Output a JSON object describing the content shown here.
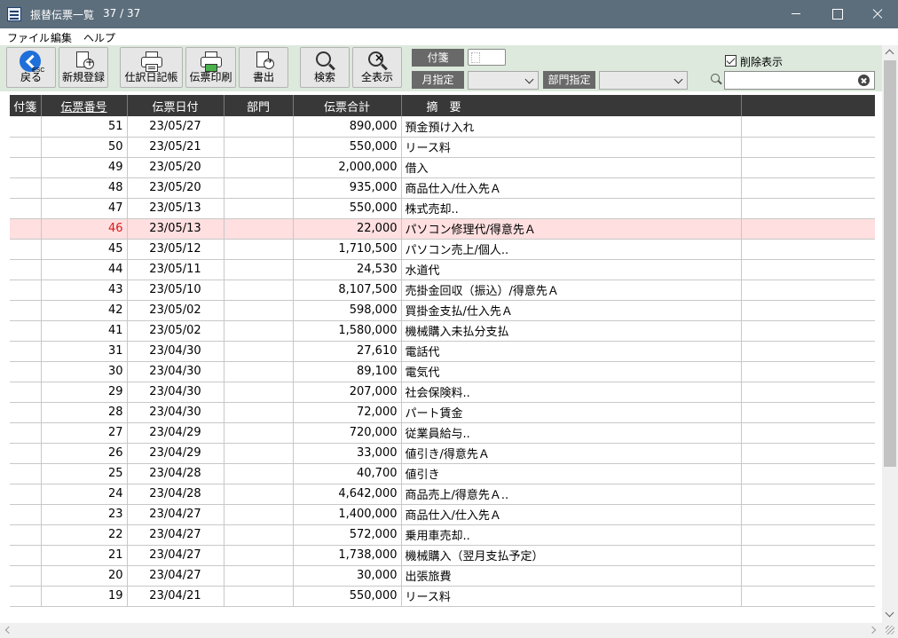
{
  "window": {
    "title": "振替伝票一覧",
    "count": "37 / 37"
  },
  "menu": [
    "ファイル",
    "編集",
    "ヘルプ"
  ],
  "toolbar": {
    "back_label": "戻る",
    "esc_label": "ESC",
    "new_label": "新規登録",
    "journal_label": "仕訳日記帳",
    "print_label": "伝票印刷",
    "export_label": "書出",
    "search_label": "検索",
    "showall_label": "全表示",
    "fusen_label": "付箋",
    "month_label": "月指定",
    "month_value": "",
    "dept_label": "部門指定",
    "dept_value": "",
    "deleted_label": "削除表示",
    "deleted_checked": true,
    "search_value": ""
  },
  "table": {
    "columns": [
      "付箋",
      "伝票番号",
      "伝票日付",
      "部門",
      "伝票合計",
      "摘　要"
    ],
    "highlight_row": 5,
    "rows": [
      {
        "fusen": "",
        "no": "51",
        "date": "23/05/27",
        "dept": "",
        "total": "890,000",
        "desc": "預金預け入れ"
      },
      {
        "fusen": "",
        "no": "50",
        "date": "23/05/21",
        "dept": "",
        "total": "550,000",
        "desc": "リース料"
      },
      {
        "fusen": "",
        "no": "49",
        "date": "23/05/20",
        "dept": "",
        "total": "2,000,000",
        "desc": "借入"
      },
      {
        "fusen": "",
        "no": "48",
        "date": "23/05/20",
        "dept": "",
        "total": "935,000",
        "desc": "商品仕入/仕入先Ａ"
      },
      {
        "fusen": "",
        "no": "47",
        "date": "23/05/13",
        "dept": "",
        "total": "550,000",
        "desc": "株式売却.."
      },
      {
        "fusen": "",
        "no": "46",
        "date": "23/05/13",
        "dept": "",
        "total": "22,000",
        "desc": "パソコン修理代/得意先Ａ"
      },
      {
        "fusen": "",
        "no": "45",
        "date": "23/05/12",
        "dept": "",
        "total": "1,710,500",
        "desc": "パソコン売上/個人.."
      },
      {
        "fusen": "",
        "no": "44",
        "date": "23/05/11",
        "dept": "",
        "total": "24,530",
        "desc": "水道代"
      },
      {
        "fusen": "",
        "no": "43",
        "date": "23/05/10",
        "dept": "",
        "total": "8,107,500",
        "desc": "売掛金回収（振込）/得意先Ａ"
      },
      {
        "fusen": "",
        "no": "42",
        "date": "23/05/02",
        "dept": "",
        "total": "598,000",
        "desc": "買掛金支払/仕入先Ａ"
      },
      {
        "fusen": "",
        "no": "41",
        "date": "23/05/02",
        "dept": "",
        "total": "1,580,000",
        "desc": "機械購入未払分支払"
      },
      {
        "fusen": "",
        "no": "31",
        "date": "23/04/30",
        "dept": "",
        "total": "27,610",
        "desc": "電話代"
      },
      {
        "fusen": "",
        "no": "30",
        "date": "23/04/30",
        "dept": "",
        "total": "89,100",
        "desc": "電気代"
      },
      {
        "fusen": "",
        "no": "29",
        "date": "23/04/30",
        "dept": "",
        "total": "207,000",
        "desc": "社会保険料.."
      },
      {
        "fusen": "",
        "no": "28",
        "date": "23/04/30",
        "dept": "",
        "total": "72,000",
        "desc": "パート賃金"
      },
      {
        "fusen": "",
        "no": "27",
        "date": "23/04/29",
        "dept": "",
        "total": "720,000",
        "desc": "従業員給与.."
      },
      {
        "fusen": "",
        "no": "26",
        "date": "23/04/29",
        "dept": "",
        "total": "33,000",
        "desc": "値引き/得意先Ａ"
      },
      {
        "fusen": "",
        "no": "25",
        "date": "23/04/28",
        "dept": "",
        "total": "40,700",
        "desc": "値引き"
      },
      {
        "fusen": "",
        "no": "24",
        "date": "23/04/28",
        "dept": "",
        "total": "4,642,000",
        "desc": "商品売上/得意先Ａ.."
      },
      {
        "fusen": "",
        "no": "23",
        "date": "23/04/27",
        "dept": "",
        "total": "1,400,000",
        "desc": "商品仕入/仕入先Ａ"
      },
      {
        "fusen": "",
        "no": "22",
        "date": "23/04/27",
        "dept": "",
        "total": "572,000",
        "desc": "乗用車売却.."
      },
      {
        "fusen": "",
        "no": "21",
        "date": "23/04/27",
        "dept": "",
        "total": "1,738,000",
        "desc": "機械購入（翌月支払予定）"
      },
      {
        "fusen": "",
        "no": "20",
        "date": "23/04/27",
        "dept": "",
        "total": "30,000",
        "desc": "出張旅費"
      },
      {
        "fusen": "",
        "no": "19",
        "date": "23/04/21",
        "dept": "",
        "total": "550,000",
        "desc": "リース料"
      }
    ]
  },
  "scroll": {
    "vertical_position": 0.0
  }
}
